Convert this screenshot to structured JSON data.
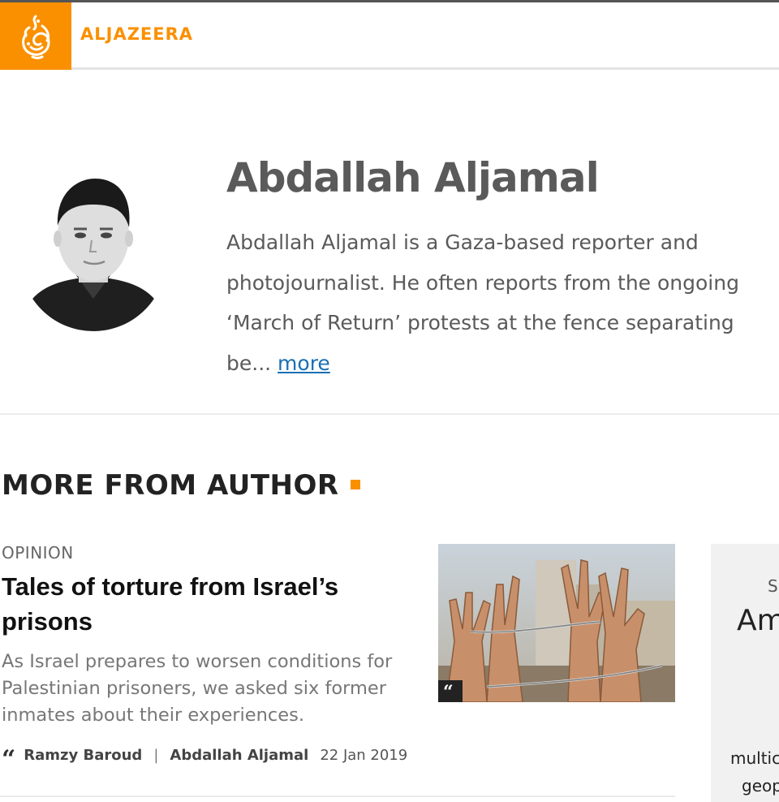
{
  "brand": {
    "name": "ALJAZEERA",
    "accent_color": "#fa9000"
  },
  "author": {
    "name": "Abdallah Aljamal",
    "bio": "Abdallah Aljamal is a Gaza-based reporter and photojournalist. He often reports from the ongoing ‘March of Return’ protests at the fence separating be...",
    "more_label": "more"
  },
  "section": {
    "title": "MORE FROM AUTHOR"
  },
  "article": {
    "kicker": "OPINION",
    "headline": "Tales of torture from Israel’s prisons",
    "summary": "As Israel prepares to worsen conditions for Palestinian prisoners, we asked six former inmates about their experiences.",
    "author_primary": "Ramzy Baroud",
    "separator": "|",
    "author_secondary": "Abdallah Aljamal",
    "date": "22 Jan 2019",
    "opinion_icon": "quote-icon",
    "thumbnail_icon": "chained-hands-photo"
  },
  "side_card": {
    "kicker": "S",
    "title": "Am",
    "text_line1": "multic",
    "text_line2": "geop"
  }
}
